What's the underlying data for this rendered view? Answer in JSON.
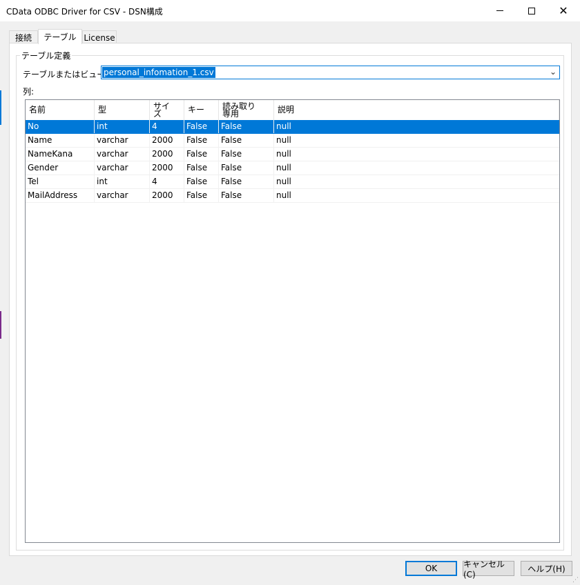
{
  "window": {
    "title": "CData ODBC Driver for CSV - DSN構成",
    "close_glyph": "✕"
  },
  "tabs": [
    {
      "label": "接続",
      "active": false
    },
    {
      "label": "テーブル",
      "active": true
    },
    {
      "label": "License",
      "active": false
    }
  ],
  "group": {
    "title": "テーブル定義",
    "table_label": "テーブルまたはビュー:",
    "table_value": "personal_infomation_1.csv",
    "columns_label": "列:"
  },
  "columns": {
    "headers": [
      [
        "名前"
      ],
      [
        "型"
      ],
      [
        "サイ",
        "ズ"
      ],
      [
        "キー"
      ],
      [
        "読み取り",
        "専用"
      ],
      [
        "説明"
      ]
    ],
    "rows": [
      [
        "No",
        "int",
        "4",
        "False",
        "False",
        "null"
      ],
      [
        "Name",
        "varchar",
        "2000",
        "False",
        "False",
        "null"
      ],
      [
        "NameKana",
        "varchar",
        "2000",
        "False",
        "False",
        "null"
      ],
      [
        "Gender",
        "varchar",
        "2000",
        "False",
        "False",
        "null"
      ],
      [
        "Tel",
        "int",
        "4",
        "False",
        "False",
        "null"
      ],
      [
        "MailAddress",
        "varchar",
        "2000",
        "False",
        "False",
        "null"
      ]
    ],
    "selected_row": 0
  },
  "buttons": {
    "ok": "OK",
    "cancel": "キャンセル(C)",
    "help": "ヘルプ(H)"
  },
  "colors": {
    "accent": "#0078d7",
    "background": "#f0f0f0"
  }
}
